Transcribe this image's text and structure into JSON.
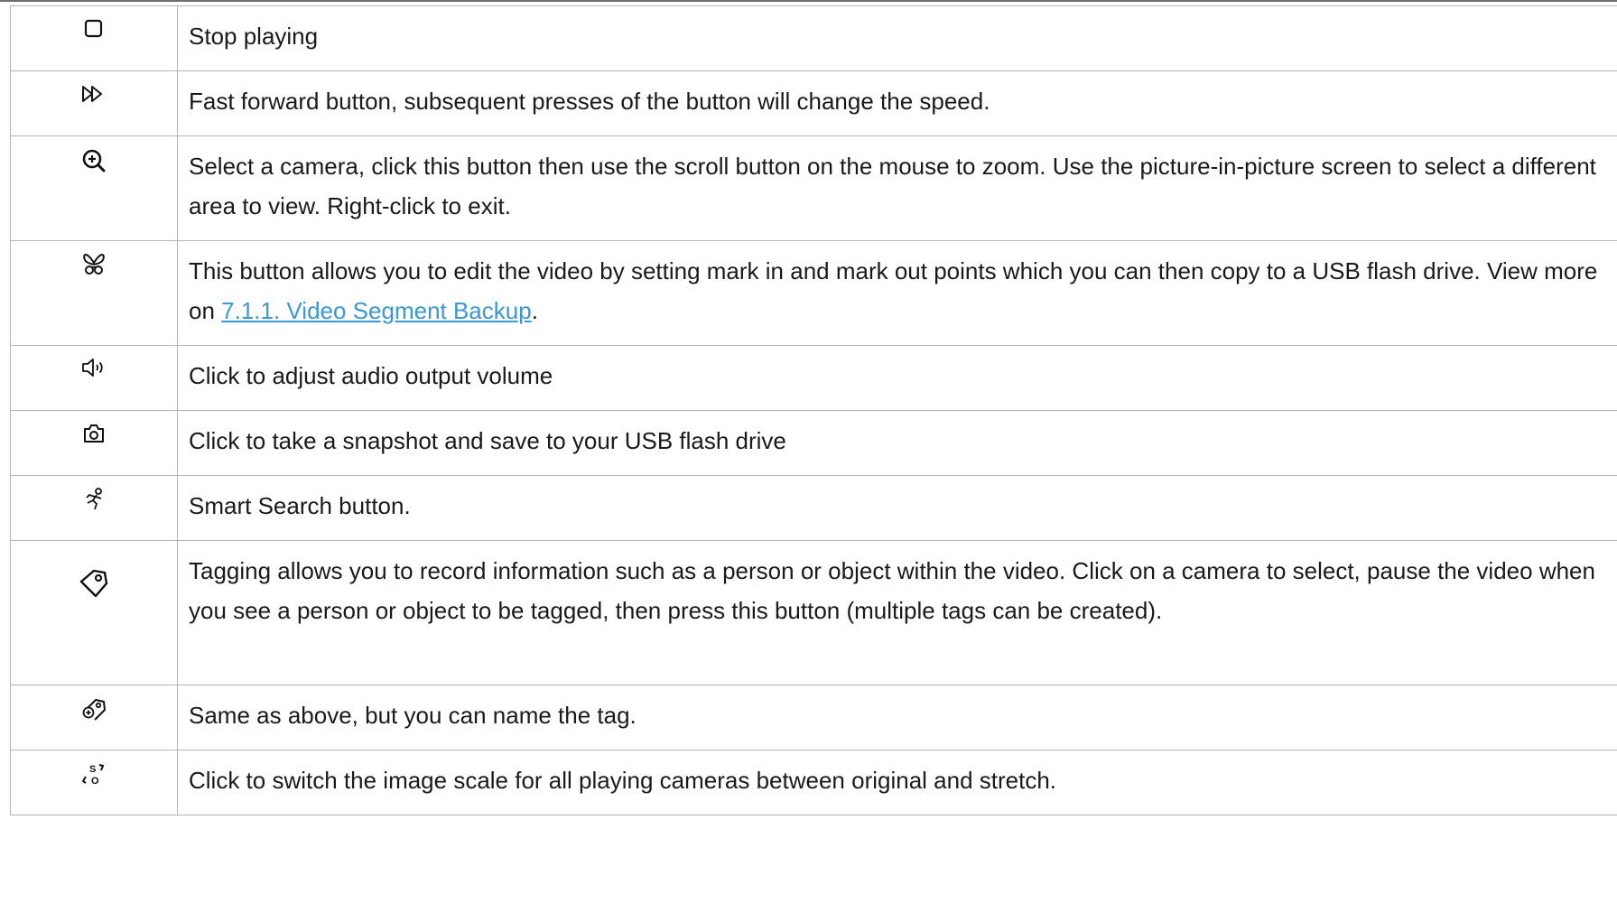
{
  "rows": [
    {
      "icon": "stop-icon",
      "text": "Stop playing"
    },
    {
      "icon": "fast-forward-icon",
      "text": "Fast forward button, subsequent presses of the button will change the speed."
    },
    {
      "icon": "zoom-in-icon",
      "text": "Select a camera, click this button then use the scroll button on the mouse to zoom. Use the picture-in-picture screen to select a different area to view. Right-click to exit."
    },
    {
      "icon": "scissors-icon",
      "text_before": "This button allows you to edit the video by setting mark in and mark out points which you can then copy to a USB flash drive. View more on ",
      "link": "7.1.1. Video Segment Backup",
      "text_after": "."
    },
    {
      "icon": "volume-icon",
      "text": "Click to adjust audio output volume"
    },
    {
      "icon": "camera-snapshot-icon",
      "text": "Click to take a snapshot and save to your USB flash drive"
    },
    {
      "icon": "smart-search-icon",
      "text": "Smart Search button."
    },
    {
      "icon": "tag-icon",
      "text": "Tagging allows you to record information such as a person or object within the video. Click on a camera to select, pause the video when you see a person or object to be tagged, then press this button (multiple tags can be created)."
    },
    {
      "icon": "named-tag-icon",
      "text": "Same as above, but you can name the tag."
    },
    {
      "icon": "scale-switch-icon",
      "text": "Click to switch the image scale for all playing cameras between original and stretch."
    }
  ]
}
